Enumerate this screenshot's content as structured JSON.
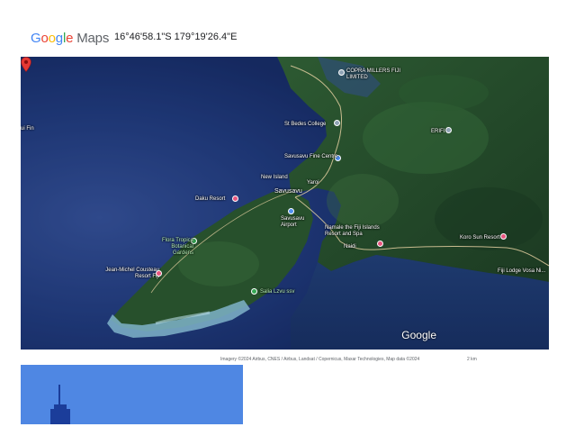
{
  "header": {
    "logo_google": "Google",
    "logo_maps": "Maps",
    "coordinates": "16°46'58.1\"S 179°19'26.4\"E"
  },
  "map": {
    "watermark": "Google",
    "places": {
      "copra": "COPRA MILLERS FIJI LIMITED",
      "st_bedes": "St Bedes College",
      "erifi": "ERIFI",
      "savusavu_fine_centre": "Savusavu Fine Centre",
      "new_island": "New Island",
      "yaroi": "Yaroi",
      "savusavu": "Savusavu",
      "daku": "Daku Resort",
      "airport": "Savusavu Airport",
      "namale": "Namale the Fiji Islands Resort and Spa",
      "naidi": "Naidi",
      "koro_sun": "Koro Sun Resort",
      "fiji_lodge": "Fiji Lodge Vosa Ni...",
      "flora_tropica": "Flora Tropica Botanical Gardens",
      "jean_michel": "Jean-Michel Cousteau Resort Fiji",
      "salia_lzvu": "Salia Lzvu ssv",
      "left_edge": "ui Fin"
    }
  },
  "footer": {
    "attribution": "Imagery ©2024 Airbus, CNES / Airbus, Landsat / Copernicus, Maxar Technologies, Map data ©2024",
    "scale": "2 km"
  },
  "colors": {
    "ocean_deep": "#1b2f68",
    "ocean_mid": "#2f4a8a",
    "land_dark": "#1f3d23",
    "land_mid": "#2e5530",
    "reef": "#7fb3c9",
    "pin_red": "#e53935",
    "thumb_blue": "#4f87e3"
  }
}
